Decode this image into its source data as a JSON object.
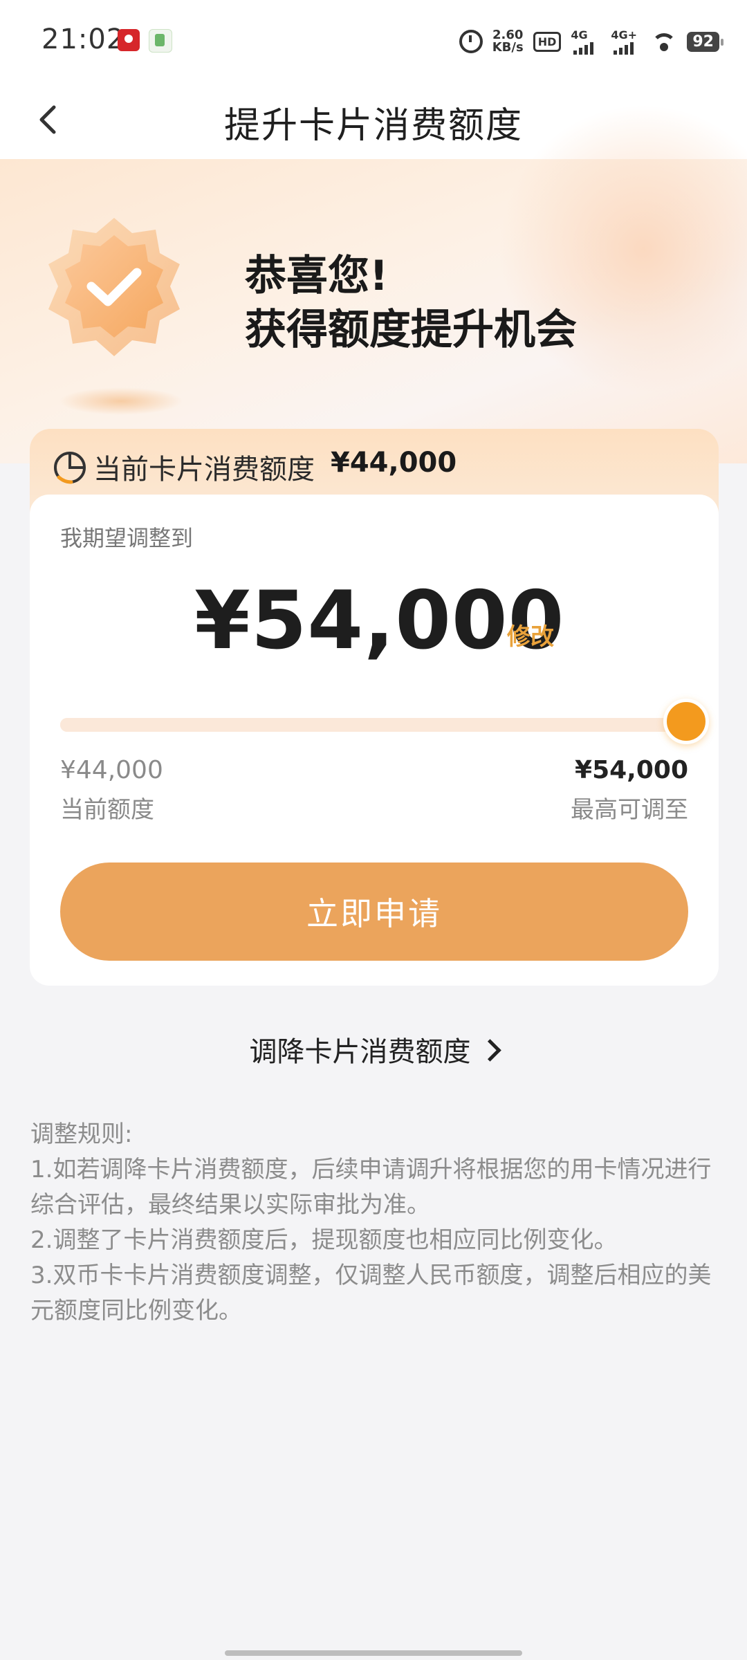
{
  "status_bar": {
    "time": "21:02",
    "net_speed_value": "2.60",
    "net_speed_unit": "KB/s",
    "hd_label": "HD",
    "sim1_type": "4G",
    "sim2_type": "4G+",
    "battery": "92"
  },
  "nav": {
    "title": "提升卡片消费额度"
  },
  "hero": {
    "line1": "恭喜您!",
    "line2": "获得额度提升机会"
  },
  "current_limit": {
    "label": "当前卡片消费额度",
    "amount": "¥44,000"
  },
  "adjust": {
    "expect_label": "我期望调整到",
    "target_amount": "¥54,000",
    "edit_label": "修改",
    "slider_fraction": 1.0,
    "min_amount": "¥44,000",
    "min_label": "当前额度",
    "max_amount": "¥54,000",
    "max_label": "最高可调至",
    "apply_label": "立即申请"
  },
  "decrease_link": "调降卡片消费额度",
  "rules": {
    "title": "调整规则:",
    "items": [
      "1.如若调降卡片消费额度，后续申请调升将根据您的用卡情况进行综合评估，最终结果以实际审批为准。",
      "2.调整了卡片消费额度后，提现额度也相应同比例变化。",
      "3.双币卡卡片消费额度调整，仅调整人民币额度，调整后相应的美元额度同比例变化。"
    ]
  },
  "colors": {
    "accent": "#f39a1e",
    "button": "#eba45c",
    "edit": "#e9a23b"
  }
}
